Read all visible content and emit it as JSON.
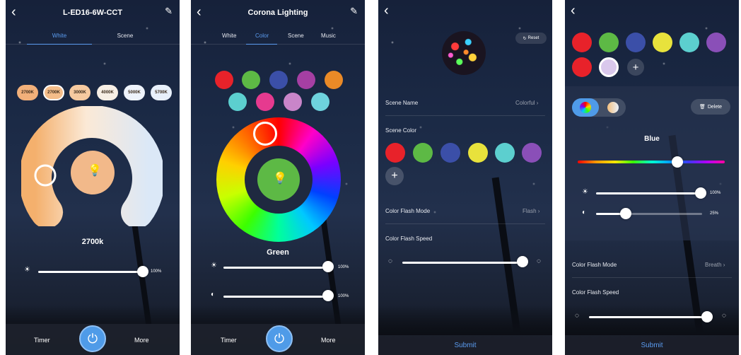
{
  "screen1": {
    "title": "L-ED16-6W-CCT",
    "tabs": [
      "White",
      "Scene"
    ],
    "temps": [
      {
        "label": "2700K",
        "color": "#f2b07a"
      },
      {
        "label": "2700K",
        "color": "#f4bd8a"
      },
      {
        "label": "3000K",
        "color": "#f6caa0"
      },
      {
        "label": "4000K",
        "color": "#f7efe6"
      },
      {
        "label": "5000K",
        "color": "#eef3fb"
      },
      {
        "label": "5700K",
        "color": "#e8f0fb"
      }
    ],
    "temp_value": "2700k",
    "brightness_pct": "100%",
    "timer_label": "Timer",
    "more_label": "More"
  },
  "screen2": {
    "title": "Corona Lighting",
    "tabs": [
      "White",
      "Color",
      "Scene",
      "Music"
    ],
    "swatches": [
      "#e8222a",
      "#5db945",
      "#3b4fa8",
      "#a53fa3",
      "#ea8a27",
      "#5ccfcf",
      "#e63a8f",
      "#c985c9",
      "#6ed2dd"
    ],
    "color_name": "Green",
    "brightness_pct": "100%",
    "saturation_pct": "100%",
    "timer_label": "Timer",
    "more_label": "More"
  },
  "screen3": {
    "reset_label": "Reset",
    "scene_name_label": "Scene Name",
    "scene_name_value": "Colorful",
    "scene_color_label": "Scene Color",
    "scene_colors": [
      "#e8222a",
      "#5db945",
      "#3b4fa8",
      "#e8e23c",
      "#5ccfcf",
      "#8a4fb8"
    ],
    "flash_mode_label": "Color Flash Mode",
    "flash_mode_value": "Flash",
    "flash_speed_label": "Color Flash Speed",
    "submit_label": "Submit"
  },
  "screen4": {
    "colors_row1": [
      "#e8222a",
      "#5db945",
      "#3b4fa8",
      "#e8e23c",
      "#5ccfcf",
      "#8a4fb8"
    ],
    "colors_row2": [
      "#e8222a",
      "#d9c8ec"
    ],
    "delete_label": "Delete",
    "color_name": "Blue",
    "brightness_pct": "100%",
    "saturation_pct": "25%",
    "flash_mode_label": "Color Flash Mode",
    "flash_mode_value": "Breath",
    "flash_speed_label": "Color Flash Speed",
    "submit_label": "Submit"
  }
}
